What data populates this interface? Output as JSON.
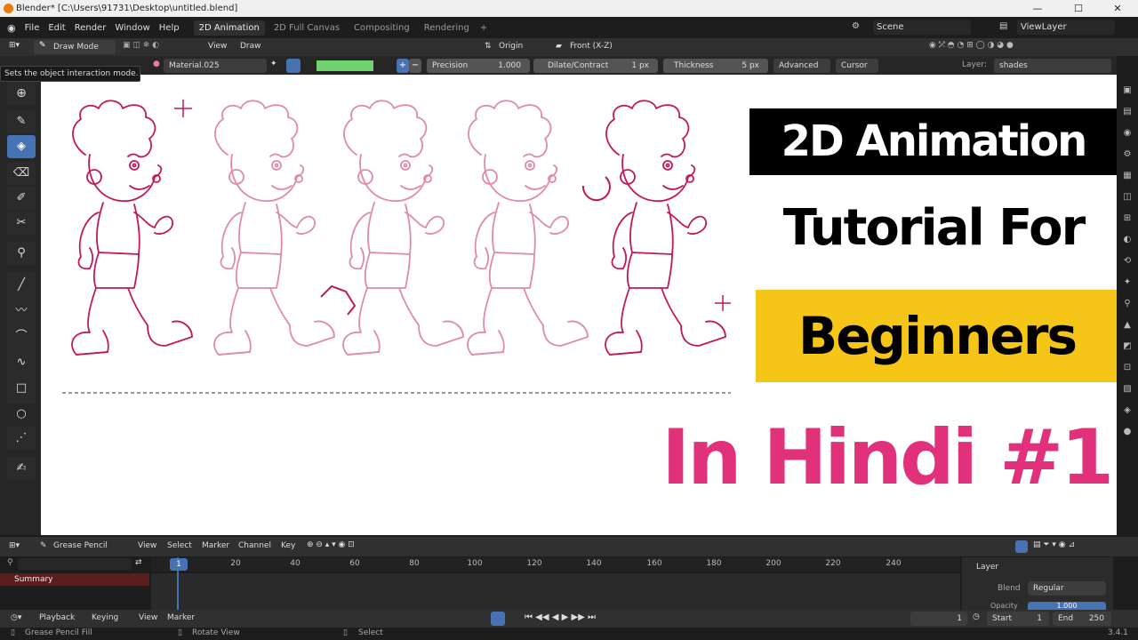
{
  "window": {
    "title": "Blender* [C:\\Users\\91731\\Desktop\\untitled.blend]",
    "minimize": "—",
    "maximize": "☐",
    "close": "✕"
  },
  "menubar": {
    "menus": [
      "File",
      "Edit",
      "Render",
      "Window",
      "Help"
    ],
    "workspaces": [
      "2D Animation",
      "2D Full Canvas",
      "Compositing",
      "Rendering",
      "+"
    ],
    "active_workspace": "2D Animation",
    "scene": "Scene",
    "view_layer": "ViewLayer"
  },
  "tool_header": {
    "mode": "Draw Mode",
    "view": "View",
    "draw": "Draw",
    "origin": "Origin",
    "orientation": "Front (X-Z)"
  },
  "tool_settings": {
    "material": "Material.025",
    "precision_label": "Precision",
    "precision_value": "1.000",
    "dilate_label": "Dilate/Contract",
    "dilate_value": "1 px",
    "thickness_label": "Thickness",
    "thickness_value": "5 px",
    "advanced": "Advanced",
    "cursor": "Cursor",
    "layer_label": "Layer:",
    "layer_value": "shades"
  },
  "tooltip": "Sets the object interaction mode.",
  "overlay": {
    "line1": "2D Animation",
    "line2": "Tutorial For",
    "line3": "Beginners",
    "line4": "In Hindi #1"
  },
  "timeline": {
    "editor": "Grease Pencil",
    "menus": [
      "View",
      "Select",
      "Marker",
      "Channel",
      "Key"
    ],
    "current_frame": "1",
    "ticks": [
      "20",
      "40",
      "60",
      "80",
      "100",
      "120",
      "140",
      "160",
      "180",
      "200",
      "220",
      "240"
    ],
    "summary": "Summary",
    "layer_panel_title": "Layer",
    "blend_label": "Blend",
    "blend_value": "Regular",
    "opacity_label": "Opacity",
    "opacity_value": "1.000"
  },
  "playback": {
    "playback": "Playback",
    "keying": "Keying",
    "view": "View",
    "marker": "Marker",
    "frame": "1",
    "start_label": "Start",
    "start_value": "1",
    "end_label": "End",
    "end_value": "250"
  },
  "statusbar": {
    "left": "Grease Pencil Fill",
    "middle": "Rotate View",
    "right": "Select",
    "version": "3.4.1"
  },
  "colors": {
    "accent": "#4772b3",
    "pink": "#e0317a",
    "yellow": "#f5c518",
    "line_dark": "#c2185b",
    "line_light": "#e08aa8"
  }
}
